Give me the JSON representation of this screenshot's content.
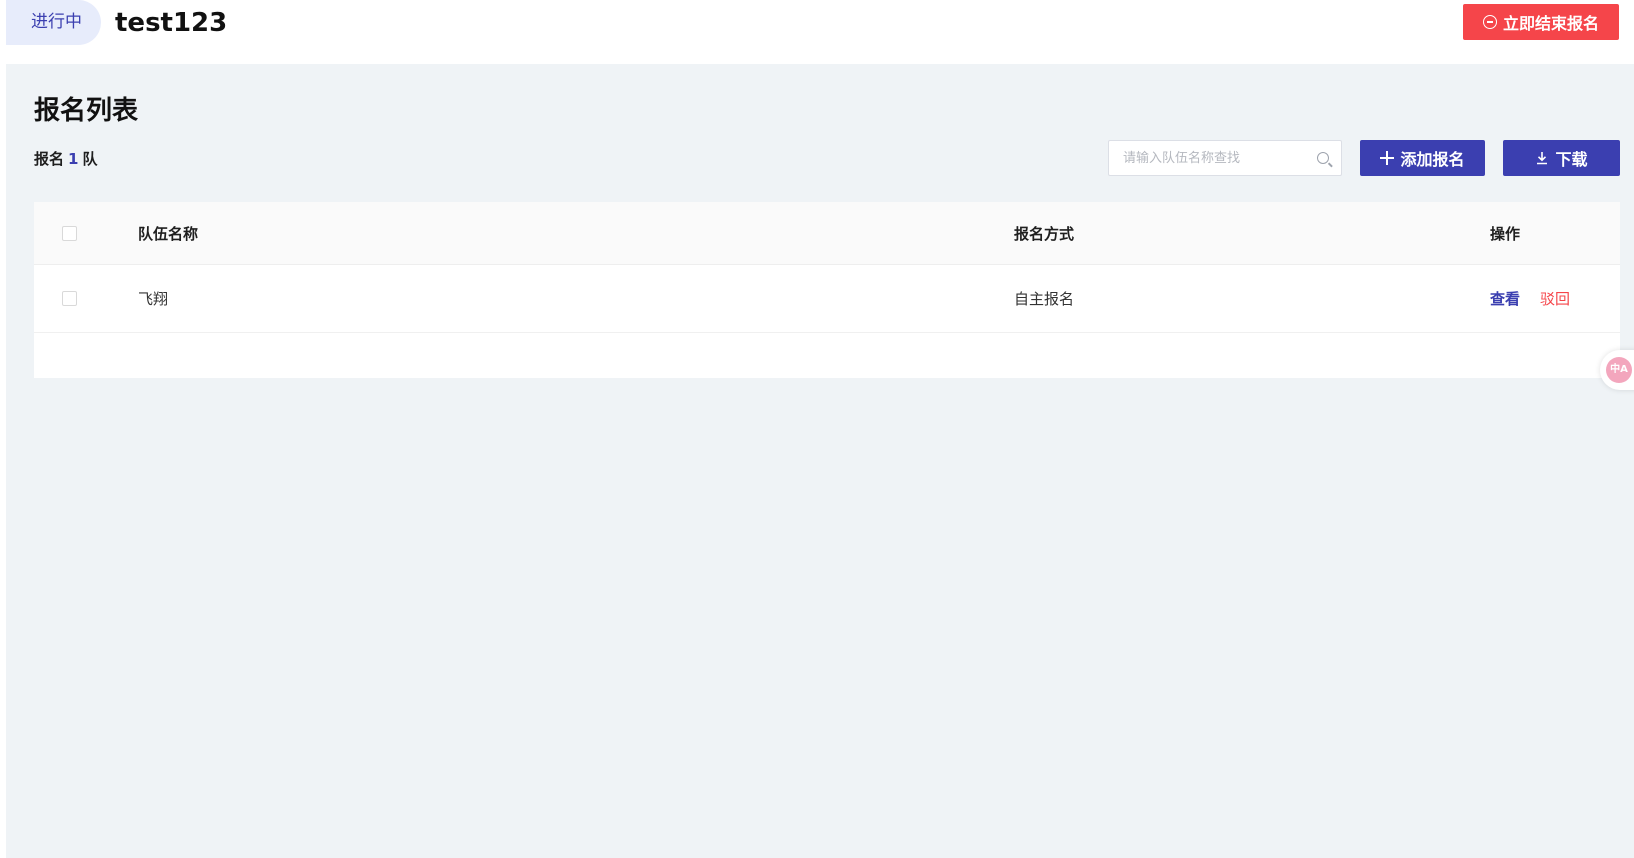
{
  "header": {
    "status_badge": "进行中",
    "event_title": "test123",
    "end_button_label": "立即结束报名"
  },
  "section": {
    "title": "报名列表",
    "count_prefix": "报名",
    "count_value": "1",
    "count_suffix": "队"
  },
  "search": {
    "placeholder": "请输入队伍名称查找",
    "value": ""
  },
  "toolbar": {
    "add_label": "添加报名",
    "download_label": "下载"
  },
  "table": {
    "columns": [
      "队伍名称",
      "报名方式",
      "操作"
    ],
    "rows": [
      {
        "team_name": "飞翔",
        "signup_mode": "自主报名",
        "actions": [
          "查看",
          "驳回"
        ]
      }
    ]
  },
  "colors": {
    "accent": "#3b3fb0",
    "danger": "#f5454a",
    "background": "#eff3f6"
  },
  "icons": [
    "minus-circle-icon",
    "search-icon",
    "plus-icon",
    "download-icon",
    "translate-icon"
  ]
}
